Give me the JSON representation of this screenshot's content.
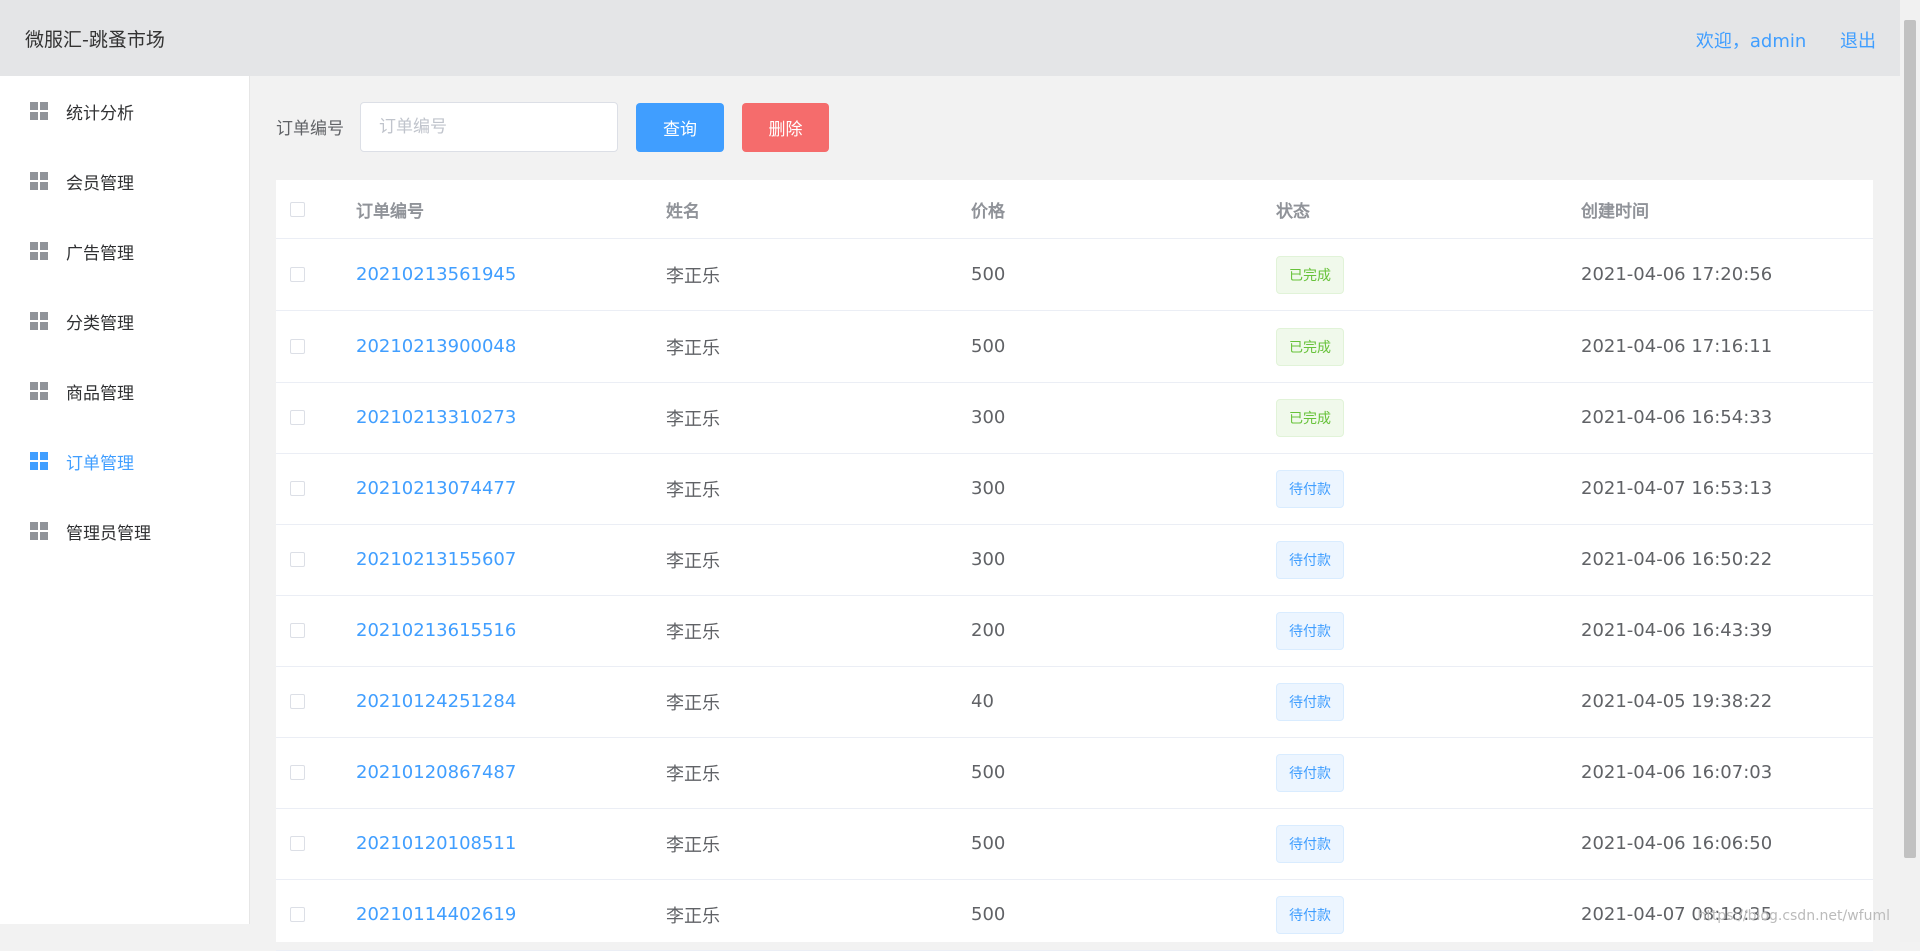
{
  "header": {
    "brand": "微服汇-跳蚤市场",
    "welcome": "欢迎，admin",
    "logout": "退出"
  },
  "sidebar": {
    "items": [
      {
        "label": "统计分析",
        "icon": "grid-icon",
        "active": false
      },
      {
        "label": "会员管理",
        "icon": "grid-icon",
        "active": false
      },
      {
        "label": "广告管理",
        "icon": "grid-icon",
        "active": false
      },
      {
        "label": "分类管理",
        "icon": "grid-icon",
        "active": false
      },
      {
        "label": "商品管理",
        "icon": "grid-icon",
        "active": false
      },
      {
        "label": "订单管理",
        "icon": "grid-icon",
        "active": true
      },
      {
        "label": "管理员管理",
        "icon": "grid-icon",
        "active": false
      }
    ]
  },
  "search": {
    "label": "订单编号",
    "placeholder": "订单编号",
    "value": "",
    "query_button": "查询",
    "delete_button": "删除"
  },
  "table": {
    "columns": [
      "订单编号",
      "姓名",
      "价格",
      "状态",
      "创建时间"
    ],
    "rows": [
      {
        "order_no": "20210213561945",
        "name": "李正乐",
        "price": "500",
        "status": "已完成",
        "created": "2021-04-06 17:20:56"
      },
      {
        "order_no": "20210213900048",
        "name": "李正乐",
        "price": "500",
        "status": "已完成",
        "created": "2021-04-06 17:16:11"
      },
      {
        "order_no": "20210213310273",
        "name": "李正乐",
        "price": "300",
        "status": "已完成",
        "created": "2021-04-06 16:54:33"
      },
      {
        "order_no": "20210213074477",
        "name": "李正乐",
        "price": "300",
        "status": "待付款",
        "created": "2021-04-07 16:53:13"
      },
      {
        "order_no": "20210213155607",
        "name": "李正乐",
        "price": "300",
        "status": "待付款",
        "created": "2021-04-06 16:50:22"
      },
      {
        "order_no": "20210213615516",
        "name": "李正乐",
        "price": "200",
        "status": "待付款",
        "created": "2021-04-06 16:43:39"
      },
      {
        "order_no": "20210124251284",
        "name": "李正乐",
        "price": "40",
        "status": "待付款",
        "created": "2021-04-05 19:38:22"
      },
      {
        "order_no": "20210120867487",
        "name": "李正乐",
        "price": "500",
        "status": "待付款",
        "created": "2021-04-06 16:07:03"
      },
      {
        "order_no": "20210120108511",
        "name": "李正乐",
        "price": "500",
        "status": "待付款",
        "created": "2021-04-06 16:06:50"
      },
      {
        "order_no": "20210114402619",
        "name": "李正乐",
        "price": "500",
        "status": "待付款",
        "created": "2021-04-07 08:18:35"
      }
    ]
  },
  "watermark": "https://blog.csdn.net/wfuml",
  "colors": {
    "primary": "#409eff",
    "danger": "#f56c6c",
    "success": "#67c23a"
  }
}
